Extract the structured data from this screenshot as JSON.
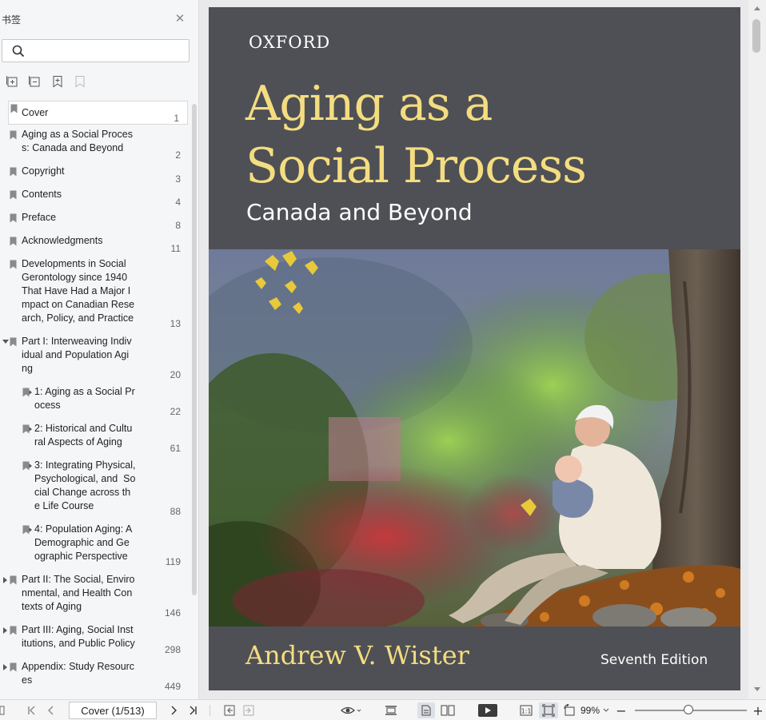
{
  "sidebar": {
    "title": "书签",
    "bookmarks": [
      {
        "label": "Cover",
        "page": "1"
      },
      {
        "label": "Aging as a Social Proces\ns: Canada and Beyond",
        "page": "2"
      },
      {
        "label": "Copyright",
        "page": "3"
      },
      {
        "label": "Contents",
        "page": "4"
      },
      {
        "label": "Preface",
        "page": "8"
      },
      {
        "label": "Acknowledgments",
        "page": "11"
      },
      {
        "label": "Developments in Social\nGerontology since 1940\nThat Have Had a Major I\nmpact on Canadian Rese\narch, Policy, and Practice",
        "page": "13"
      },
      {
        "label": "Part I: Interweaving Indiv\nidual and Population Agi\nng",
        "page": "20"
      },
      {
        "label": "1: Aging as a Social Pr\nocess",
        "page": "22"
      },
      {
        "label": "2: Historical and Cultu\nral Aspects of Aging",
        "page": "61"
      },
      {
        "label": "3: Integrating Physical,\nPsychological, and  So\ncial Change across th\ne Life Course",
        "page": "88"
      },
      {
        "label": "4: Population Aging: A\nDemographic and Ge\nographic Perspective",
        "page": "119"
      },
      {
        "label": "Part II: The Social, Enviro\nnmental, and Health Con\ntexts of Aging",
        "page": "146"
      },
      {
        "label": "Part III: Aging, Social Inst\nitutions, and Public Policy",
        "page": "298"
      },
      {
        "label": "Appendix: Study Resourc\nes",
        "page": "449"
      }
    ]
  },
  "cover": {
    "publisher": "OXFORD",
    "title_line1": "Aging as a",
    "title_line2": "Social Process",
    "subtitle": "Canada and Beyond",
    "author": "Andrew V. Wister",
    "edition": "Seventh Edition"
  },
  "toolbar": {
    "page_indicator": "Cover (1/513)",
    "zoom": "99%",
    "fit_label": "1:1"
  },
  "colors": {
    "cover_bg": "#4f5055",
    "title_yellow": "#f4dd80"
  }
}
